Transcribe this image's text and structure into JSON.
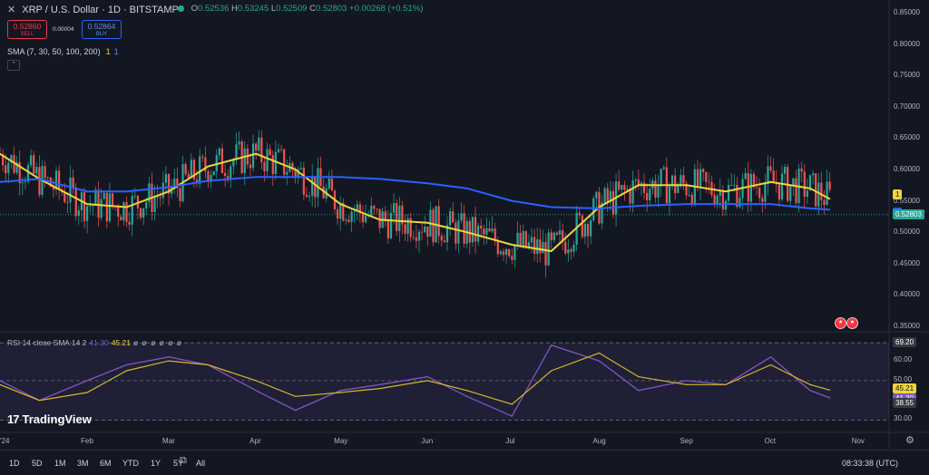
{
  "header": {
    "symbol_title": "XRP / U.S. Dollar · 1D · BITSTAMP",
    "open_label": "O",
    "open": "0.52536",
    "high_label": "H",
    "high": "0.53245",
    "low_label": "L",
    "low": "0.52509",
    "close_label": "C",
    "close": "0.52803",
    "change": "+0.00268 (+0.51%)"
  },
  "trade": {
    "sell_price": "0.52860",
    "sell_label": "SELL",
    "spread": "0.00004",
    "buy_price": "0.52864",
    "buy_label": "BUY"
  },
  "sma_indicator": {
    "label": "SMA (7, 30, 50, 100, 200)",
    "v1": "1",
    "v2": "1"
  },
  "rsi_indicator": {
    "label": "RSI 14 close SMA 14 2",
    "rsi_value": "41.30",
    "sma_value": "45.21",
    "extras": "ø ø ø ø ø ø"
  },
  "price_axis": {
    "ticks": [
      "0.85000",
      "0.80000",
      "0.75000",
      "0.70000",
      "0.65000",
      "0.60000",
      "0.55000",
      "0.50000",
      "0.45000",
      "0.40000",
      "0.35000"
    ],
    "sma_tag_yellow": "1",
    "sma_tag_blue": "1",
    "last_price": "0.52803"
  },
  "rsi_axis": {
    "ticks": [
      "69.20",
      "60.00",
      "50.00",
      "45.21",
      "41.30",
      "38.55",
      "30.00"
    ]
  },
  "time_axis": {
    "labels": [
      "'24",
      "Feb",
      "Mar",
      "Apr",
      "May",
      "Jun",
      "Jul",
      "Aug",
      "Sep",
      "Oct",
      "Nov"
    ]
  },
  "branding": {
    "logo_text": "TradingView",
    "logo_mark": "17"
  },
  "bottom_bar": {
    "ranges": [
      "1D",
      "5D",
      "1M",
      "3M",
      "6M",
      "YTD",
      "1Y",
      "5Y",
      "All"
    ],
    "time": "08:33:38 (UTC)"
  },
  "colors": {
    "up": "#26a69a",
    "down": "#ef5350",
    "sma_yellow": "#f0d43a",
    "sma_blue": "#2962ff",
    "rsi": "#7e57c2",
    "rsi_sma": "#d4b82a",
    "background": "#131722"
  },
  "chart_data": {
    "type": "line",
    "series": [
      {
        "name": "SMA (7, 30, 50, 100, 200)",
        "x": [
          "2024-01-01",
          "2024-01-15",
          "2024-02-01",
          "2024-02-15",
          "2024-03-01",
          "2024-03-15",
          "2024-04-01",
          "2024-04-15",
          "2024-05-01",
          "2024-05-15",
          "2024-06-01",
          "2024-06-15",
          "2024-07-01",
          "2024-07-15",
          "2024-08-01",
          "2024-08-15",
          "2024-09-01",
          "2024-09-15",
          "2024-10-01",
          "2024-10-15",
          "2024-10-22"
        ],
        "values": [
          0.625,
          0.585,
          0.545,
          0.54,
          0.565,
          0.605,
          0.625,
          0.6,
          0.545,
          0.52,
          0.515,
          0.5,
          0.48,
          0.47,
          0.54,
          0.575,
          0.575,
          0.565,
          0.58,
          0.57,
          0.553
        ]
      },
      {
        "name": "SMA (7, 30, 50, 100, 200)",
        "x": [
          "2024-01-01",
          "2024-01-15",
          "2024-02-01",
          "2024-02-15",
          "2024-03-01",
          "2024-03-15",
          "2024-04-01",
          "2024-04-15",
          "2024-05-01",
          "2024-05-15",
          "2024-06-01",
          "2024-06-15",
          "2024-07-01",
          "2024-07-15",
          "2024-08-01",
          "2024-08-15",
          "2024-09-01",
          "2024-09-15",
          "2024-10-01",
          "2024-10-15",
          "2024-10-22"
        ],
        "values": [
          0.58,
          0.585,
          0.565,
          0.565,
          0.572,
          0.582,
          0.588,
          0.588,
          0.588,
          0.585,
          0.578,
          0.57,
          0.55,
          0.54,
          0.538,
          0.542,
          0.545,
          0.545,
          0.545,
          0.538,
          0.536
        ]
      }
    ],
    "price_range": [
      0.35,
      0.85
    ],
    "rsi": {
      "x": [
        "2024-01-01",
        "2024-01-15",
        "2024-02-01",
        "2024-02-15",
        "2024-03-01",
        "2024-03-15",
        "2024-04-01",
        "2024-04-15",
        "2024-05-01",
        "2024-05-15",
        "2024-06-01",
        "2024-06-15",
        "2024-07-01",
        "2024-07-15",
        "2024-08-01",
        "2024-08-15",
        "2024-09-01",
        "2024-09-15",
        "2024-10-01",
        "2024-10-15",
        "2024-10-22"
      ],
      "rsi_values": [
        50,
        40,
        50,
        58,
        62,
        58,
        45,
        35,
        45,
        48,
        52,
        42,
        32,
        68,
        60,
        45,
        50,
        48,
        62,
        45,
        41.3
      ],
      "sma_values": [
        48,
        40,
        44,
        55,
        60,
        58,
        50,
        42,
        44,
        46,
        50,
        45,
        38,
        55,
        64,
        52,
        48,
        48,
        58,
        48,
        45.21
      ],
      "upper_band": 69.2,
      "lower_band": 30,
      "range": [
        27,
        72
      ]
    }
  }
}
